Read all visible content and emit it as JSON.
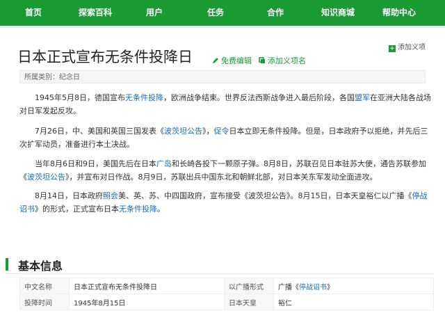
{
  "nav": {
    "items": [
      {
        "label": "首页"
      },
      {
        "label": "探索百科"
      },
      {
        "label": "用户"
      },
      {
        "label": "任务"
      },
      {
        "label": "合作"
      },
      {
        "label": "知识商城"
      },
      {
        "label": "帮助中心"
      }
    ],
    "color": "#1a9a32"
  },
  "page": {
    "title": "日本正式宣布无条件投降日",
    "edit_label": "免费编辑",
    "add_item_label": "添加义项名",
    "add_meaning_label": "添加义项",
    "category": "所属类别：纪念日"
  },
  "paragraphs": [
    {
      "p1": "1945年5月8日，德国宣布",
      "l1": "无条件投降",
      "p2": "，欧洲战争结束。世界反法西斯战争进入最后阶段，各国",
      "l2": "盟军",
      "p3": "在亚洲大陆各战场对日军发起反攻。"
    },
    {
      "p1": "7月26日，中、美国和英国三国发表《",
      "l1": "波茨坦公告",
      "p2": "》，",
      "l2": "促令",
      "p3": "日本立即无条件投降。但是，日本政府予以拒绝，并先后三次扩军动员，准备进行本土决战。"
    },
    {
      "p1": "当年8月6日和9日，美国先后在日本",
      "l1": "广岛",
      "p2": "和长崎各投下一颗原子弹。8月8日，苏联召见日本驻苏大使，通告苏联参加《",
      "l2": "波茨坦公告",
      "p3": "》，并宣布对日作战。8月9日，苏联出兵中国东北和朝鲜北部，对日本关东军发动全面进攻。"
    },
    {
      "p1": "8月14日，日本政府",
      "l1": "照会",
      "p2": "美、英、苏、中四国政府，宣布接受《波茨坦公告》。8月15日，日本天皇裕仁以广播《",
      "l2": "停战诏书",
      "p3": "》的形式，正式宣布日本",
      "l3": "无条件投降",
      "p4": "。"
    }
  ],
  "info": {
    "title": "基本信息",
    "rows": [
      {
        "k1": "中文名称",
        "v1": "日本正式宣布无条件投降日",
        "k2": "以广播形式",
        "v2a": "广播《",
        "v2link": "停战诏书",
        "v2b": "》"
      },
      {
        "k1": "投降时间",
        "v1": "1945年8月15日",
        "k2": "日本天皇",
        "v2a": "裕仁",
        "v2link": "",
        "v2b": ""
      }
    ]
  }
}
